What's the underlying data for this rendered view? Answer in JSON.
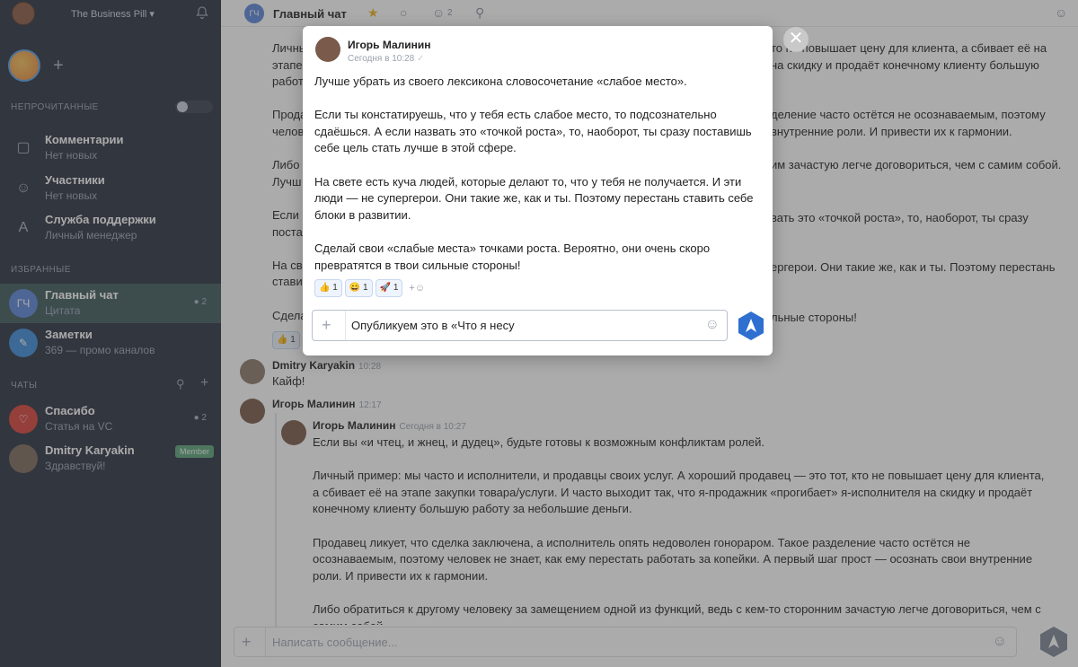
{
  "sidebar": {
    "workspace": "The Business Pill ▾",
    "sections": {
      "unread": "НЕПРОЧИТАННЫЕ",
      "favorites": "ИЗБРАННЫЕ",
      "chats": "ЧАТЫ"
    },
    "unread_items": [
      {
        "title": "Комментарии",
        "subtitle": "Нет новых"
      },
      {
        "title": "Участники",
        "subtitle": "Нет новых"
      },
      {
        "title": "Служба поддержки",
        "subtitle": "Личный менеджер"
      }
    ],
    "favorite_items": [
      {
        "title": "Главный чат",
        "subtitle": "Цитата",
        "initials": "ГЧ",
        "count": "2"
      },
      {
        "title": "Заметки",
        "subtitle": "369 — промо каналов"
      }
    ],
    "chat_items": [
      {
        "title": "Спасибо",
        "subtitle": "Статья на VC",
        "count": "2"
      },
      {
        "title": "Dmitry Karyakin",
        "subtitle": "Здравствуй!",
        "badge": "Member"
      }
    ]
  },
  "header": {
    "initials": "ГЧ",
    "title": "Главный чат",
    "members": "2"
  },
  "background_messages": {
    "lines": [
      "Личный",
      "этапе",
      "работ",
      "Прода",
      "челов",
      "Либо",
      "Лучш",
      "Если",
      "поста",
      "На све",
      "стави",
      "Сдела"
    ],
    "right_lines": [
      "то не повышает цену для клиента, а сбивает её на",
      "на скидку и продаёт конечному клиенту большую",
      "деление часто остётся не осознаваемым, поэтому",
      "внутренние роли. И привести их к гармонии.",
      "им зачастую легче договориться, чем с самим собой.",
      "вать это «точкой роста», то, наоборот, ты сразу",
      "ергерои. Они такие же, как и ты. Поэтому перестань",
      "льные стороны!"
    ],
    "reaction_count": "1",
    "dmitry": {
      "author": "Dmitry Karyakin",
      "time": "10:28",
      "text": "Кайф!"
    },
    "igor": {
      "author": "Игорь Малинин",
      "time": "12:17"
    },
    "quoted": {
      "author": "Игорь Малинин",
      "time": "Сегодня в 10:27",
      "paragraphs": [
        "Если вы «и чтец, и жнец, и дудец», будьте готовы к возможным конфликтам ролей.",
        "Личный пример: мы часто и исполнители, и продавцы своих услуг. А хороший продавец — это тот, кто не повышает цену для клиента, а сбивает её на этапе закупки товара/услуги. И часто выходит так, что я-продажник «прогибает» я-исполнителя на скидку и продаёт конечному клиенту большую работу за небольшие деньги.",
        "Продавец ликует, что сделка заключена, а исполнитель опять недоволен гонораром. Такое разделение часто остётся не осознаваемым, поэтому человек не знает, как ему перестать работать за копейки. А первый шаг прост — осознать свои внутренние роли. И привести их к гармонии.",
        "Либо обратиться к другому человеку за замещением одной из функций, ведь с кем-то сторонним зачастую легче договориться, чем с самим собой."
      ]
    }
  },
  "composer": {
    "placeholder": "Написать сообщение..."
  },
  "modal": {
    "author": "Игорь Малинин",
    "time": "Сегодня в 10:28",
    "paragraphs": [
      "Лучше убрать из своего лексикона словосочетание «слабое место».",
      "Если ты констатируешь, что у тебя есть слабое место, то подсознательно сдаёшься. А если назвать это «точкой роста», то, наоборот, ты сразу поставишь себе цель стать лучше в этой сфере.",
      "На свете есть куча людей, которые делают то, что у тебя не получается. И эти люди — не супергерои. Они такие же, как и ты. Поэтому перестань ставить себе блоки в развитии.",
      "Сделай свои «слабые места» точками роста. Вероятно, они очень скоро превратятся в твои сильные стороны!"
    ],
    "reactions": [
      {
        "emoji": "👍",
        "count": "1"
      },
      {
        "emoji": "😄",
        "count": "1"
      },
      {
        "emoji": "🚀",
        "count": "1"
      }
    ],
    "add_reaction": "+☺",
    "input_value": "Опубликуем это в «Что я несу"
  },
  "colors": {
    "sidebar_bg": "#2b3240",
    "accent": "#2f6fd0",
    "active_item": "#3f5a5c"
  }
}
